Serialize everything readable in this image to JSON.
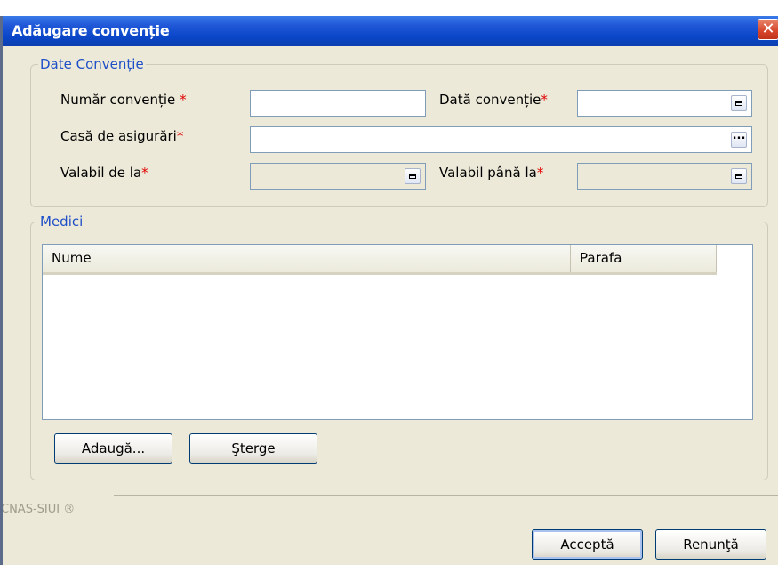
{
  "window": {
    "title": "Adăugare convenție"
  },
  "group_date": {
    "legend": "Date Convenție",
    "numar_label": "Număr convenție",
    "data_label": "Dată convenție",
    "casa_label": "Casă de asigurări",
    "valabil_de_label": "Valabil de la",
    "valabil_pana_label": "Valabil până la",
    "required_mark": "*",
    "numar_value": "",
    "data_value": "",
    "casa_value": "",
    "valabil_de_value": "",
    "valabil_pana_value": "",
    "browse_glyph": "..."
  },
  "group_medici": {
    "legend": "Medici",
    "columns": [
      "Nume",
      "Parafa"
    ],
    "rows": [],
    "add_label": "Adaugă...",
    "delete_label": "Şterge"
  },
  "footer": {
    "brand": "CNAS-SIUI ®",
    "accept_label": "Acceptă",
    "cancel_label": "Renunţă"
  },
  "colors": {
    "titlebar": "#0a46c8",
    "dialog_bg": "#ece9d8",
    "legend": "#1f4fc8",
    "required": "#e00000"
  }
}
